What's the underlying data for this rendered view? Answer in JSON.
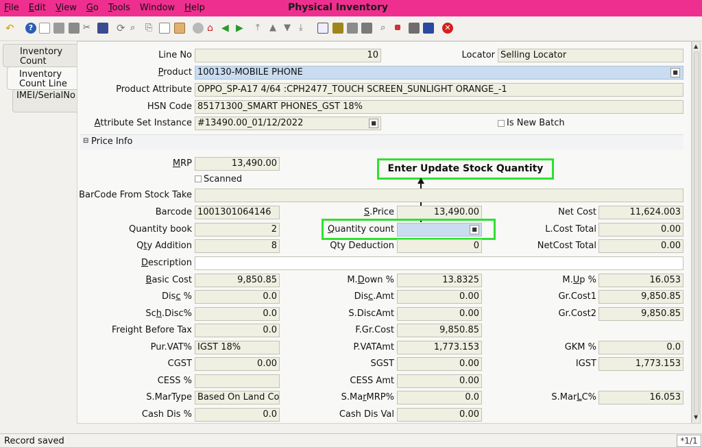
{
  "app": {
    "title": "Physical Inventory"
  },
  "menu": [
    {
      "key": "F",
      "rest": "ile"
    },
    {
      "key": "E",
      "rest": "dit"
    },
    {
      "key": "V",
      "rest": "iew"
    },
    {
      "key": "G",
      "rest": "o"
    },
    {
      "key": "T",
      "rest": "ools"
    },
    {
      "key": "",
      "rest": "Window"
    },
    {
      "key": "H",
      "rest": "elp"
    }
  ],
  "tabs": [
    {
      "label": "Inventory Count"
    },
    {
      "label": "Inventory Count Line"
    },
    {
      "label": "IMEI/SerialNo"
    }
  ],
  "form": {
    "line_no": {
      "label": "Line No",
      "value": "10"
    },
    "locator": {
      "label": "Locator",
      "value": "Selling Locator"
    },
    "product": {
      "label": "Product",
      "value": "100130-MOBILE PHONE"
    },
    "product_attribute": {
      "label": "Product Attribute",
      "value": "OPPO_SP-A17 4/64 :CPH2477_TOUCH SCREEN_SUNLIGHT ORANGE_-1"
    },
    "hsn_code": {
      "label": "HSN Code",
      "value": "85171300_SMART PHONES_GST 18%"
    },
    "attribute_set_instance": {
      "label": "Attribute Set Instance",
      "value": "#13490.00_01/12/2022"
    },
    "is_new_batch": {
      "label": "Is New Batch"
    },
    "price_info": {
      "label": "Price Info"
    },
    "mrp": {
      "label": "MRP",
      "value": "13,490.00"
    },
    "scanned": {
      "label": "Scanned"
    },
    "barcode_from_stock_take": {
      "label": "BarCode From Stock Take",
      "value": ""
    },
    "barcode": {
      "label": "Barcode",
      "value": "1001301064146"
    },
    "s_price": {
      "label": "S.Price",
      "value": "13,490.00"
    },
    "net_cost": {
      "label": "Net Cost",
      "value": "11,624.003"
    },
    "quantity_book": {
      "label": "Quantity book",
      "value": "2"
    },
    "quantity_count": {
      "label": "Quantity count",
      "value": ""
    },
    "l_cost_total": {
      "label": "L.Cost Total",
      "value": "0.00"
    },
    "qty_addition": {
      "label": "Qty Addition",
      "value": "8"
    },
    "qty_deduction": {
      "label": "Qty Deduction",
      "value": "0"
    },
    "netcost_total": {
      "label": "NetCost Total",
      "value": "0.00"
    },
    "description": {
      "label": "Description",
      "value": ""
    },
    "basic_cost": {
      "label": "Basic Cost",
      "value": "9,850.85"
    },
    "m_down": {
      "label": "M.Down %",
      "value": "13.8325"
    },
    "m_up": {
      "label": "M.Up %",
      "value": "16.053"
    },
    "disc_pct": {
      "label": "Disc %",
      "value": "0.0"
    },
    "disc_amt": {
      "label": "Disc.Amt",
      "value": "0.00"
    },
    "gr_cost1": {
      "label": "Gr.Cost1",
      "value": "9,850.85"
    },
    "sch_disc": {
      "label": "Sch.Disc%",
      "value": "0.0"
    },
    "s_disc_amt": {
      "label": "S.DiscAmt",
      "value": "0.00"
    },
    "gr_cost2": {
      "label": "Gr.Cost2",
      "value": "9,850.85"
    },
    "freight_before_tax": {
      "label": "Freight Before Tax",
      "value": "0.0"
    },
    "f_gr_cost": {
      "label": "F.Gr.Cost",
      "value": "9,850.85"
    },
    "pur_vat": {
      "label": "Pur.VAT%",
      "value": "IGST 18%"
    },
    "p_vat_amt": {
      "label": "P.VATAmt",
      "value": "1,773.153"
    },
    "gkm": {
      "label": "GKM %",
      "value": "0.0"
    },
    "cgst": {
      "label": "CGST",
      "value": "0.00"
    },
    "sgst": {
      "label": "SGST",
      "value": "0.00"
    },
    "igst": {
      "label": "IGST",
      "value": "1,773.153"
    },
    "cess_pct": {
      "label": "CESS %",
      "value": ""
    },
    "cess_amt": {
      "label": "CESS Amt",
      "value": "0.00"
    },
    "s_mar_type": {
      "label": "S.MarType",
      "value": "Based On Land Cost"
    },
    "s_mar_mrp": {
      "label": "S.MarMRP%",
      "value": "0.0"
    },
    "s_mar_lc": {
      "label": "S.MarLC%",
      "value": "16.053"
    },
    "cash_dis_pct": {
      "label": "Cash Dis %",
      "value": "0.0"
    },
    "cash_dis_val": {
      "label": "Cash Dis Val",
      "value": "0.00"
    }
  },
  "callout": {
    "text": "Enter Update Stock Quantity"
  },
  "status": {
    "message": "Record saved",
    "pager": "*1/1"
  },
  "colors": {
    "title_bar": "#ef2f8f",
    "highlight": "#2fe02f",
    "field_blue": "#c9dcf0"
  }
}
